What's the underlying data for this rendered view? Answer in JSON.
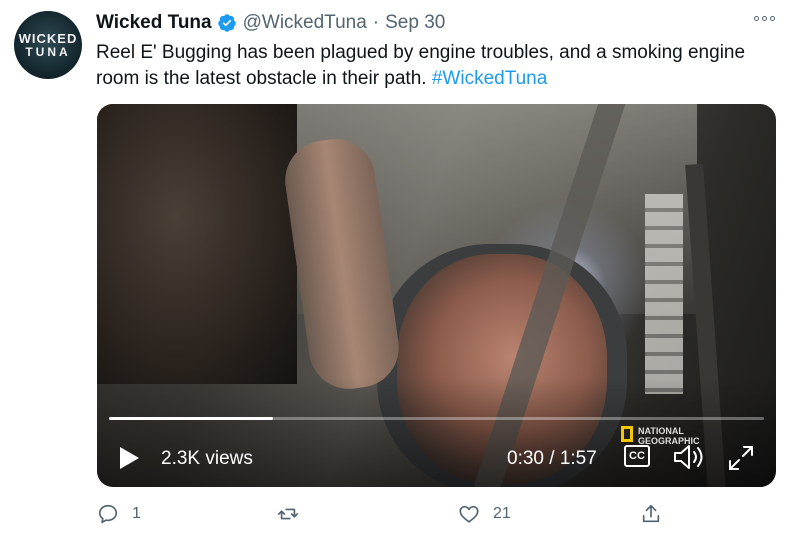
{
  "tweet": {
    "avatar": {
      "line1": "WICKED",
      "line2": "TUNA"
    },
    "author_name": "Wicked Tuna",
    "handle": "@WickedTuna",
    "separator": "·",
    "date": "Sep 30",
    "text": "Reel E' Bugging has been plagued by engine troubles, and a smoking engine room is the latest obstacle in their path. ",
    "hashtag": "#WickedTuna"
  },
  "video": {
    "views": "2.3K views",
    "time": "0:30 / 1:57",
    "progress_fraction": 0.25,
    "cc_label": "CC",
    "watermark": {
      "line1": "NATIONAL",
      "line2": "GEOGRAPHIC"
    }
  },
  "actions": {
    "reply_count": "1",
    "retweet_count": "",
    "like_count": "21"
  },
  "colors": {
    "accent": "#1d9bf0",
    "secondary_text": "#536471",
    "watermark": "#f4c800"
  }
}
